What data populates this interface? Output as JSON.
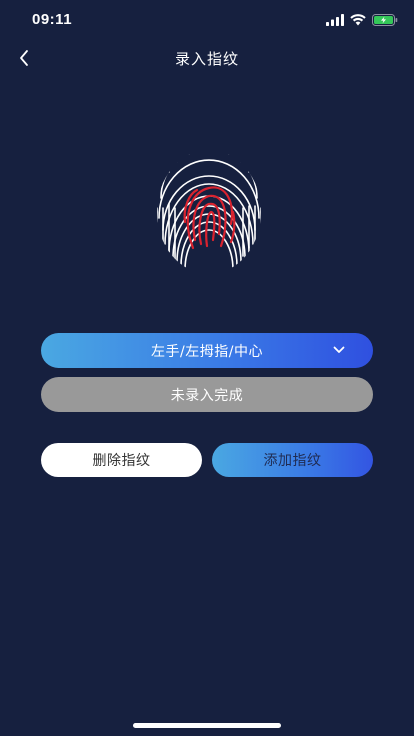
{
  "status_bar": {
    "time": "09:11",
    "icons": [
      "signal-icon",
      "wifi-icon",
      "battery-charging-icon"
    ],
    "battery_color": "#34c759"
  },
  "nav": {
    "title": "录入指纹",
    "back_icon": "chevron-left-icon"
  },
  "fingerprint": {
    "icon": "fingerprint-icon",
    "outer_color": "#ffffff",
    "highlight_color": "#d9232f"
  },
  "finger_select": {
    "selected_value": "左手/左拇指/中心",
    "icon": "chevron-down-icon"
  },
  "enroll_status": {
    "label": "未录入完成"
  },
  "actions": {
    "delete_label": "删除指纹",
    "add_label": "添加指纹"
  },
  "colors": {
    "background": "#16203f",
    "accent_gradient_start": "#4aa8e2",
    "accent_gradient_end": "#2f50e0",
    "disabled_gray": "#999999"
  }
}
